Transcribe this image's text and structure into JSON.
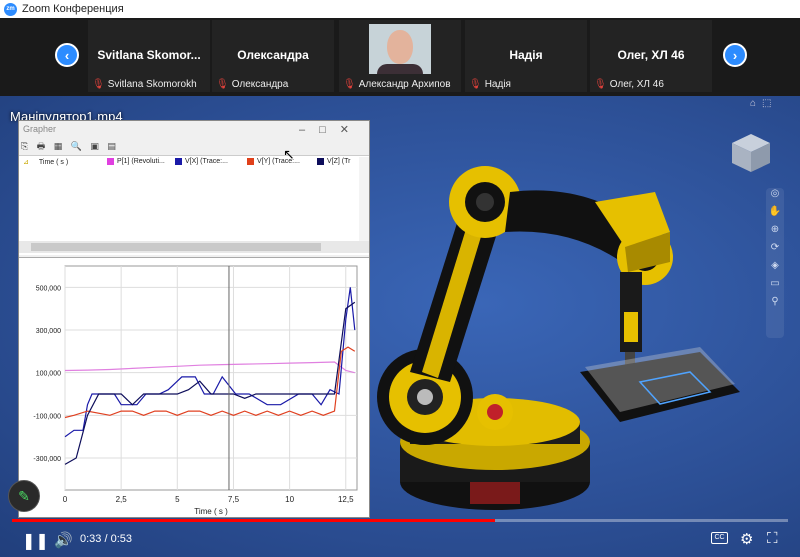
{
  "window": {
    "title": "Zoom Конференция",
    "logo": "zm"
  },
  "strip": {
    "prev_label": "‹",
    "next_label": "›",
    "tiles": [
      {
        "name": "Svitlana  Skomor...",
        "footer": "Svitlana Skomorokh"
      },
      {
        "name": "Олександра",
        "footer": "Олександра"
      },
      {
        "name": "",
        "footer": "Александр Архипов"
      },
      {
        "name": "Надія",
        "footer": "Надія"
      },
      {
        "name": "Олег, ХЛ 46",
        "footer": "Олег, ХЛ 46"
      }
    ]
  },
  "video": {
    "title": "Маніпулятор1.mp4",
    "time": "0:33 / 0:53",
    "progress_fraction": 0.6226
  },
  "grapher": {
    "title": "Grapher",
    "toolbar": "⎘ 🖶 ▦ 🔍 ▣ ▤",
    "columns": [
      {
        "label": "Time ( s )",
        "color": ""
      },
      {
        "label": "P[1] (Revoluti...",
        "color": "#e040e0"
      },
      {
        "label": "V[X] (Trace:...",
        "color": "#1a1aa8"
      },
      {
        "label": "V[Y] (Trace:...",
        "color": "#e0401a"
      },
      {
        "label": "V[Z] (Tr",
        "color": "#0d0d5a"
      }
    ]
  },
  "chart_data": {
    "type": "line",
    "xlabel": "Time ( s )",
    "ylabel": "",
    "xlim": [
      0,
      13
    ],
    "ylim": [
      -450000,
      600000
    ],
    "xticks": [
      "0",
      "2,5",
      "5",
      "7,5",
      "10",
      "12,5"
    ],
    "yticks": [
      "500,000",
      "300,000",
      "100,000",
      "-100,000",
      "-300,000"
    ],
    "ytick_values": [
      500000,
      300000,
      100000,
      -100000,
      -300000
    ],
    "xtick_values": [
      0,
      2.5,
      5,
      7.5,
      10,
      12.5
    ],
    "series": [
      {
        "color": "#e080e0",
        "x": [
          0,
          1,
          2,
          3,
          4,
          5,
          6,
          7,
          8,
          9,
          10,
          11,
          12,
          12.5,
          12.9
        ],
        "y": [
          110000,
          112000,
          115000,
          120000,
          125000,
          130000,
          135000,
          138000,
          140000,
          142000,
          145000,
          147000,
          150000,
          110000,
          100000
        ]
      },
      {
        "color": "#1a1aa8",
        "x": [
          0,
          0.4,
          0.8,
          1.0,
          1.2,
          2.2,
          2.5,
          3.2,
          3.6,
          4.2,
          4.6,
          5.2,
          5.8,
          6.2,
          6.6,
          7.0,
          7.6,
          8.2,
          9.0,
          9.6,
          10.4,
          11.0,
          11.4,
          11.8,
          12.2,
          12.5,
          12.7,
          12.9
        ],
        "y": [
          -200000,
          -170000,
          -170000,
          -50000,
          0,
          0,
          -50000,
          -50000,
          0,
          0,
          20000,
          80000,
          80000,
          0,
          0,
          80000,
          0,
          0,
          -50000,
          -50000,
          0,
          0,
          -50000,
          20000,
          0,
          350000,
          500000,
          300000
        ]
      },
      {
        "color": "#e04020",
        "x": [
          0,
          0.4,
          1.0,
          2.0,
          2.5,
          3.0,
          3.5,
          4.0,
          4.5,
          5.0,
          5.5,
          6.0,
          6.5,
          7.0,
          7.5,
          8.0,
          8.5,
          9.0,
          9.5,
          10.0,
          10.5,
          11.0,
          11.5,
          12.0,
          12.3,
          12.6,
          12.9
        ],
        "y": [
          -110000,
          -100000,
          -80000,
          -100000,
          -80000,
          -80000,
          -100000,
          -80000,
          -80000,
          -100000,
          -80000,
          -80000,
          -100000,
          -80000,
          -100000,
          -80000,
          -100000,
          -80000,
          -100000,
          -80000,
          -100000,
          -80000,
          -100000,
          -80000,
          200000,
          220000,
          200000
        ]
      },
      {
        "color": "#0d0d5a",
        "x": [
          0,
          0.5,
          1.0,
          1.5,
          2.0,
          2.5,
          3.0,
          3.5,
          4.0,
          4.5,
          5.0,
          5.5,
          6.0,
          6.5,
          7.0,
          7.5,
          8.0,
          8.5,
          9.0,
          9.5,
          10.0,
          10.5,
          11.0,
          11.5,
          12.0,
          12.5,
          12.9
        ],
        "y": [
          -330000,
          -300000,
          -100000,
          0,
          0,
          0,
          -50000,
          0,
          0,
          0,
          0,
          20000,
          60000,
          0,
          0,
          0,
          -20000,
          0,
          0,
          0,
          0,
          0,
          0,
          0,
          0,
          400000,
          430000
        ]
      }
    ]
  },
  "icons": {
    "mic_muted": "mic-muted-icon",
    "play_pause": "pause-icon",
    "volume": "volume-icon",
    "cc": "cc-icon",
    "settings": "gear-icon",
    "fullscreen": "fullscreen-icon",
    "annotate": "pencil-icon"
  },
  "player": {
    "cc_label": "CC",
    "pause_glyph": "❚❚",
    "volume_glyph": "🔊",
    "gear_glyph": "⚙",
    "fullscreen_glyph": "⛶",
    "pencil_glyph": "✎"
  }
}
